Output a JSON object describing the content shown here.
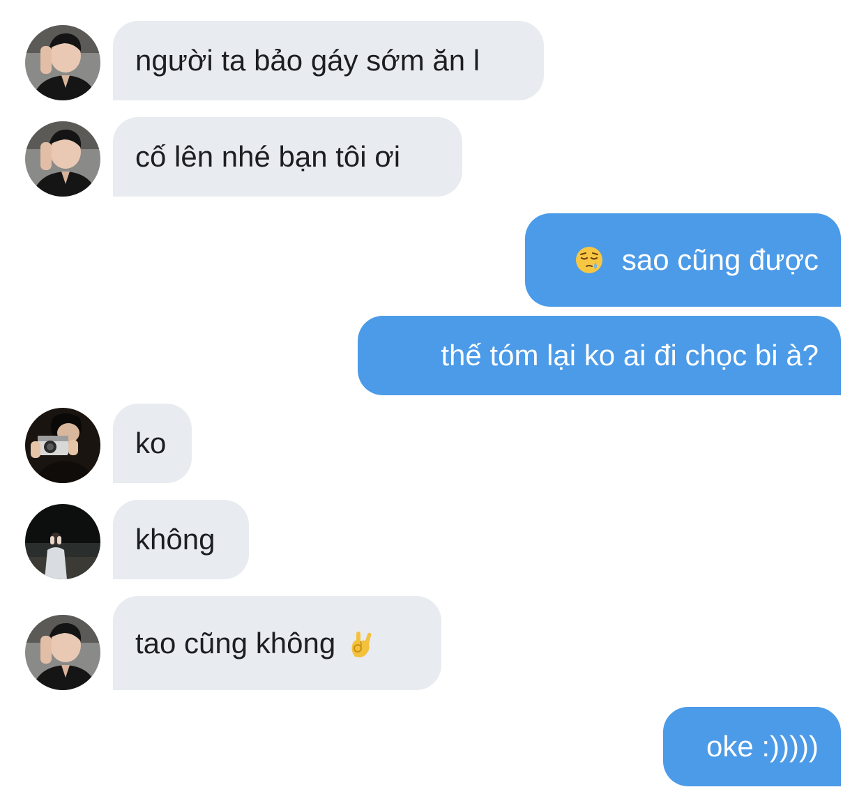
{
  "conversation": {
    "messages": [
      {
        "direction": "received",
        "sender_avatar": "avatar-guy-hand-on-face",
        "text": "người ta bảo gáy sớm ăn l"
      },
      {
        "direction": "received",
        "sender_avatar": "avatar-guy-hand-on-face",
        "text": "cố lên nhé bạn tôi ơi"
      },
      {
        "direction": "sent",
        "emoji": "sleepy-face-emoji",
        "text": "sao cũng được"
      },
      {
        "direction": "sent",
        "text": "thế tóm lại ko ai đi chọc bi à?"
      },
      {
        "direction": "received",
        "sender_avatar": "avatar-guy-with-camera",
        "text": "ko"
      },
      {
        "direction": "received",
        "sender_avatar": "avatar-person-at-beach-night",
        "text": "không"
      },
      {
        "direction": "received",
        "sender_avatar": "avatar-guy-hand-on-face",
        "text": "tao cũng không",
        "emoji": "ok-hand-emoji"
      },
      {
        "direction": "sent",
        "text": "oke :)))))"
      }
    ]
  },
  "colors": {
    "received_bubble": "#e8ebef",
    "received_text": "#1c1e21",
    "sent_bubble": "#4c9be8",
    "sent_text": "#ffffff"
  }
}
